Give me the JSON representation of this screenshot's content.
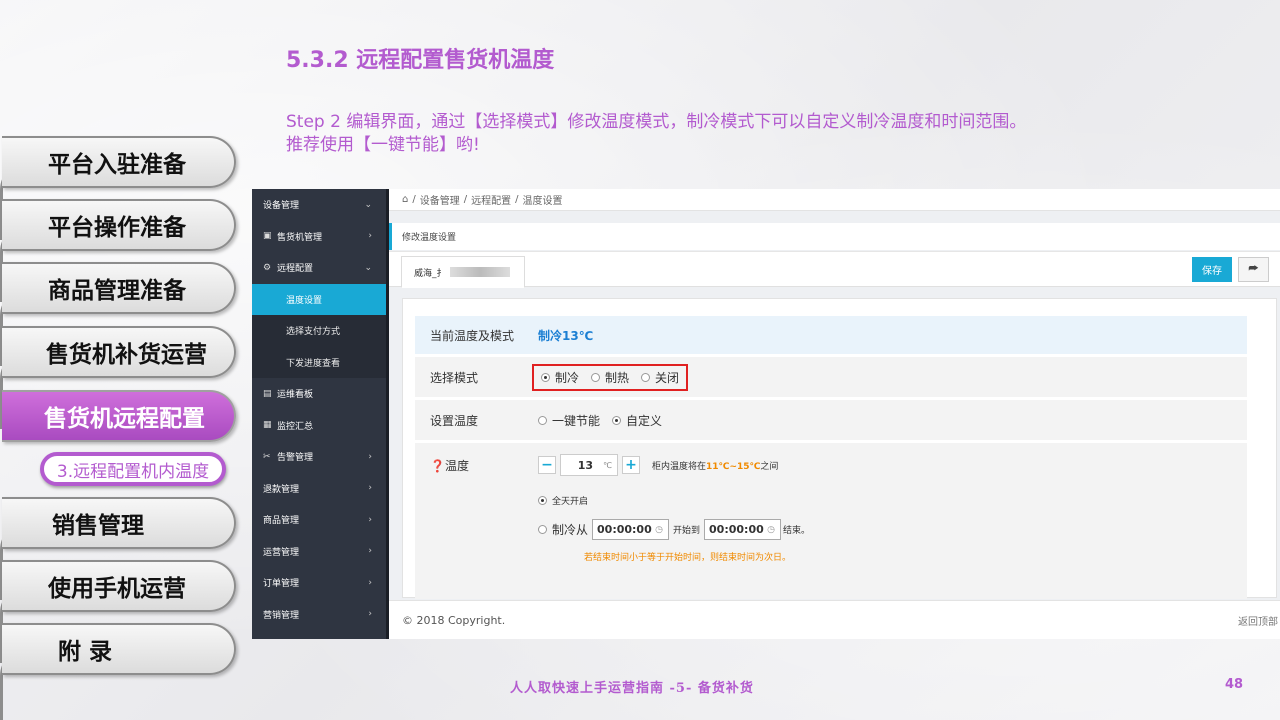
{
  "slide": {
    "title": "5.3.2 远程配置售货机温度",
    "desc_line1": "Step 2 编辑界面，通过【选择模式】修改温度模式，制冷模式下可以自定义制冷温度和时间范围。",
    "desc_line2": "推荐使用【一键节能】哟!",
    "footer_text": "人人取快速上手运营指南 -5- 备货补货",
    "page_number": "48",
    "accent_color": "#b35bcf"
  },
  "nav_tabs": [
    "平台入驻准备",
    "平台操作准备",
    "商品管理准备",
    "售货机补货运营",
    "售货机远程配置",
    "销售管理",
    "使用手机运营",
    "附 录"
  ],
  "nav_active_sub": "3.远程配置机内温度",
  "app": {
    "sidebar": [
      {
        "label": "设备管理",
        "icon": "",
        "arrow": "⌄"
      },
      {
        "label": "售货机管理",
        "icon": "▣",
        "arrow": "›"
      },
      {
        "label": "远程配置",
        "icon": "⚙",
        "arrow": "⌄"
      },
      {
        "label": "温度设置",
        "icon": "",
        "arrow": ""
      },
      {
        "label": "选择支付方式",
        "icon": "",
        "arrow": ""
      },
      {
        "label": "下发进度查看",
        "icon": "",
        "arrow": ""
      },
      {
        "label": "运维看板",
        "icon": "▤",
        "arrow": ""
      },
      {
        "label": "监控汇总",
        "icon": "▦",
        "arrow": ""
      },
      {
        "label": "告警管理",
        "icon": "✂",
        "arrow": "›"
      },
      {
        "label": "退款管理",
        "icon": "",
        "arrow": "›"
      },
      {
        "label": "商品管理",
        "icon": "",
        "arrow": "›"
      },
      {
        "label": "运营管理",
        "icon": "",
        "arrow": "›"
      },
      {
        "label": "订单管理",
        "icon": "",
        "arrow": "›"
      },
      {
        "label": "营销管理",
        "icon": "",
        "arrow": "›"
      }
    ],
    "breadcrumb": [
      "设备管理",
      "远程配置",
      "温度设置"
    ],
    "panel_title": "修改温度设置",
    "device_tab": "威海_扌",
    "save_label": "保存",
    "share_icon": "⮫",
    "form": {
      "current_label": "当前温度及模式",
      "current_value": "制冷13℃",
      "mode_label": "选择模式",
      "mode_options": [
        "制冷",
        "制热",
        "关闭"
      ],
      "settemp_label": "设置温度",
      "settemp_options": [
        "一键节能",
        "自定义"
      ],
      "temp_label": "温度",
      "temp_value": "13",
      "temp_unit": "℃",
      "range_prefix": "柜内温度将在",
      "range_value": "11℃~15℃",
      "range_suffix": "之间",
      "allday_label": "全天开启",
      "cool_from_label": "制冷从",
      "start_time": "00:00:00",
      "start_to_label": "开始到",
      "end_time": "00:00:00",
      "end_label": "结束。",
      "hint": "若结束时间小于等于开始时间，则结束时间为次日。"
    },
    "copyright": "© 2018 Copyright.",
    "back_to_top": "返回顶部"
  }
}
